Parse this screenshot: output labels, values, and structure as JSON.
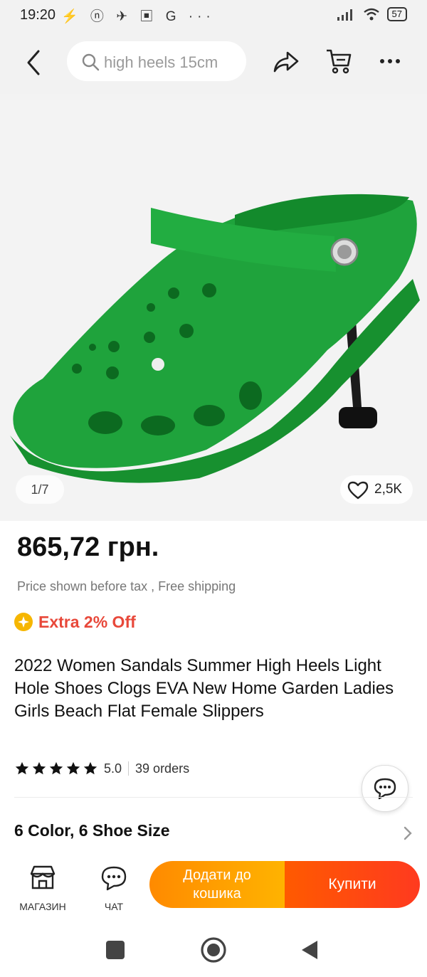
{
  "status_bar": {
    "time": "19:20",
    "notification_icons": "⚡ ⓝ ✈ ▣ G ···",
    "battery": "57"
  },
  "search": {
    "placeholder": "high heels 15cm"
  },
  "gallery": {
    "counter": "1/7",
    "wishlist_count": "2,5K"
  },
  "product": {
    "price": "865,72 грн.",
    "tax_note": "Price shown before tax , Free shipping",
    "promo": "Extra 2% Off",
    "title": "2022 Women Sandals Summer High Heels Light Hole Shoes Clogs EVA New Home Garden Ladies Girls Beach Flat Female Slippers",
    "rating": "5.0",
    "stars": 5,
    "orders": "39 orders",
    "variants": "6 Color, 6 Shoe Size"
  },
  "actions": {
    "store_label": "МАГАЗИН",
    "chat_label": "ЧАТ",
    "add_to_cart": "Додати до кошика",
    "buy": "Купити"
  },
  "colors": {
    "accent_orange": "#ff8a00",
    "buy_red": "#ff3a1f",
    "promo_red": "#e8483a",
    "shoe_green": "#1fa33c"
  }
}
